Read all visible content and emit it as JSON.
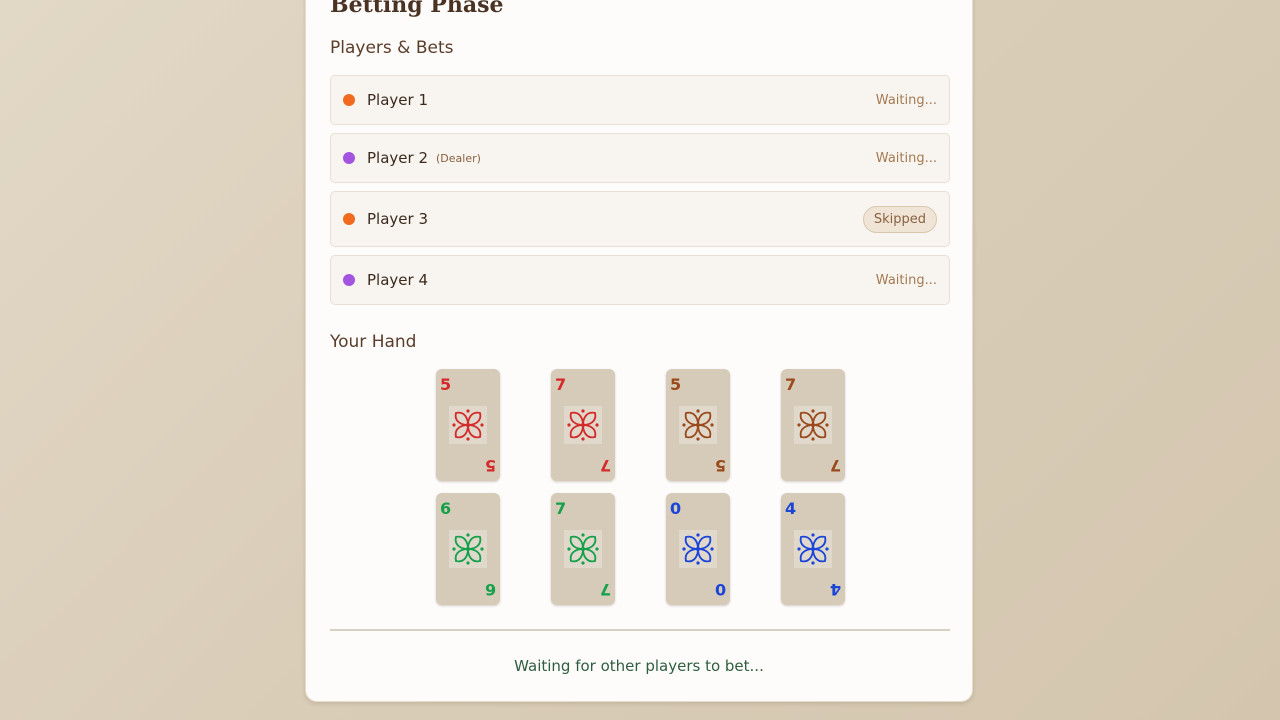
{
  "phase": {
    "title": "Betting Phase"
  },
  "players_section": {
    "title": "Players & Bets"
  },
  "players": [
    {
      "name": "Player 1",
      "dealer_label": "",
      "status": "Waiting...",
      "status_type": "waiting",
      "color": "#f06a1f"
    },
    {
      "name": "Player 2",
      "dealer_label": "(Dealer)",
      "status": "Waiting...",
      "status_type": "waiting",
      "color": "#a355e0"
    },
    {
      "name": "Player 3",
      "dealer_label": "",
      "status": "Skipped",
      "status_type": "skipped",
      "color": "#f06a1f"
    },
    {
      "name": "Player 4",
      "dealer_label": "",
      "status": "Waiting...",
      "status_type": "waiting",
      "color": "#a355e0"
    }
  ],
  "hand_section": {
    "title": "Your Hand"
  },
  "hand": [
    {
      "value": "5",
      "suit": "red",
      "color": "#d42a2a"
    },
    {
      "value": "7",
      "suit": "red",
      "color": "#d42a2a"
    },
    {
      "value": "5",
      "suit": "brown",
      "color": "#9a4a1c"
    },
    {
      "value": "7",
      "suit": "brown",
      "color": "#9a4a1c"
    },
    {
      "value": "6",
      "suit": "green",
      "color": "#15a04a"
    },
    {
      "value": "7",
      "suit": "green",
      "color": "#15a04a"
    },
    {
      "value": "0",
      "suit": "blue",
      "color": "#1a45d8"
    },
    {
      "value": "4",
      "suit": "blue",
      "color": "#1a45d8"
    }
  ],
  "footer": {
    "status": "Waiting for other players to bet..."
  }
}
